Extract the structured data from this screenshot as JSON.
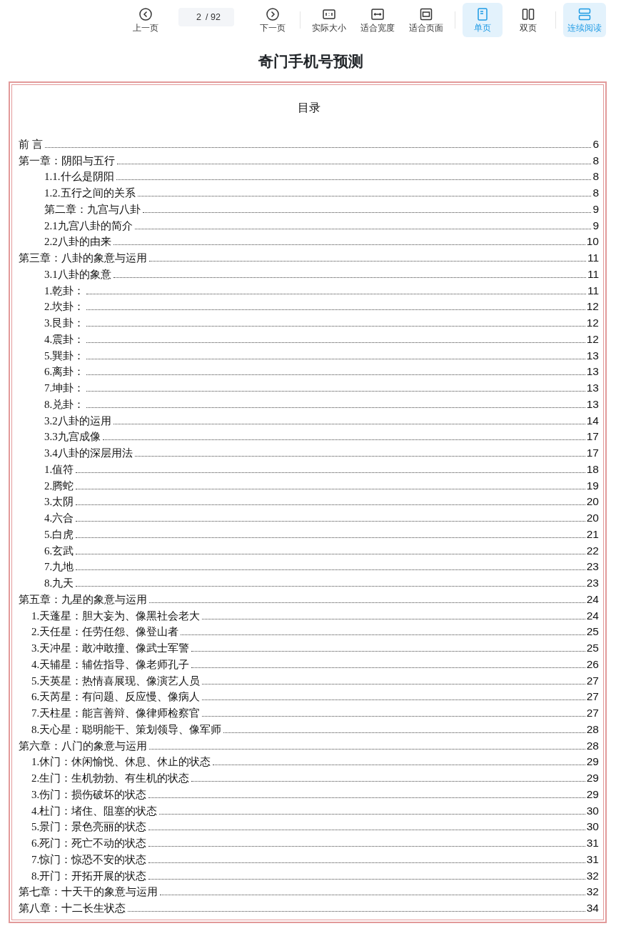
{
  "toolbar": {
    "items": [
      {
        "kind": "prev",
        "label": "上一页"
      },
      {
        "kind": "page",
        "value": "2",
        "total": "/ 92"
      },
      {
        "kind": "next",
        "label": "下一页"
      },
      {
        "kind": "sep"
      },
      {
        "kind": "actual",
        "label": "实际大小"
      },
      {
        "kind": "fitwidth",
        "label": "适合宽度"
      },
      {
        "kind": "fitpage",
        "label": "适合页面"
      },
      {
        "kind": "sep"
      },
      {
        "kind": "single",
        "label": "单页",
        "selected": true
      },
      {
        "kind": "double",
        "label": "双页",
        "selected": false
      },
      {
        "kind": "sep"
      },
      {
        "kind": "continuous",
        "label": "连续阅读",
        "selected": true
      }
    ]
  },
  "document": {
    "title": "奇门手机号预测",
    "toc_heading": "目录",
    "entries": [
      {
        "label": "前 言",
        "page": "6"
      },
      {
        "label": "第一章：阴阳与五行",
        "page": "8",
        "children": [
          {
            "label": "1.1.什么是阴阳",
            "page": "8",
            "kind": "section"
          },
          {
            "label": "1.2.五行之间的关系",
            "page": "8",
            "kind": "section"
          },
          {
            "label": "第二章：九宫与八卦",
            "page": "9",
            "kind": "section"
          },
          {
            "label": "2.1九宫八卦的简介",
            "page": "9",
            "kind": "section"
          },
          {
            "label": "2.2八卦的由来",
            "page": "10",
            "kind": "section"
          }
        ]
      },
      {
        "label": "第三章：八卦的象意与运用",
        "page": "11",
        "children": [
          {
            "label": "3.1八卦的象意",
            "page": "11",
            "kind": "section"
          },
          {
            "label": "1.乾卦：",
            "page": "11",
            "kind": "section"
          },
          {
            "label": "2.坎卦：",
            "page": "12",
            "kind": "section"
          },
          {
            "label": "3.艮卦：",
            "page": "12",
            "kind": "section"
          },
          {
            "label": "4.震卦：",
            "page": "12",
            "kind": "section"
          },
          {
            "label": "5.巽卦：",
            "page": "13",
            "kind": "section"
          },
          {
            "label": "6.离卦：",
            "page": "13",
            "kind": "section"
          },
          {
            "label": "7.坤卦：",
            "page": "13",
            "kind": "section"
          },
          {
            "label": "8.兑卦：",
            "page": "13",
            "kind": "section"
          },
          {
            "label": "3.2八卦的运用",
            "page": "14",
            "kind": "section"
          },
          {
            "label": "3.3九宫成像",
            "page": "17",
            "kind": "section"
          },
          {
            "label": "3.4八卦的深层用法",
            "page": "17",
            "kind": "section"
          },
          {
            "label": "1.值符",
            "page": "18",
            "kind": "section"
          },
          {
            "label": "2.腾蛇",
            "page": "19",
            "kind": "section"
          },
          {
            "label": "3.太阴",
            "page": "20",
            "kind": "section"
          },
          {
            "label": "4.六合",
            "page": "20",
            "kind": "section"
          },
          {
            "label": "5.白虎",
            "page": "21",
            "kind": "section"
          },
          {
            "label": "6.玄武",
            "page": "22",
            "kind": "section"
          },
          {
            "label": "7.九地",
            "page": "23",
            "kind": "section"
          },
          {
            "label": "8.九天",
            "page": "23",
            "kind": "section"
          }
        ]
      },
      {
        "label": "第五章：九星的象意与运用",
        "page": "24",
        "children": [
          {
            "label": "1.天蓬星：胆大妄为、像黑社会老大",
            "page": "24",
            "kind": "item"
          },
          {
            "label": "2.天任星：任劳任怨、像登山者",
            "page": "25",
            "kind": "item"
          },
          {
            "label": "3.天冲星：敢冲敢撞、像武士军警",
            "page": "25",
            "kind": "item"
          },
          {
            "label": "4.天辅星：辅佐指导、像老师孔子",
            "page": "26",
            "kind": "item"
          },
          {
            "label": "5.天英星：热情喜展现、像演艺人员",
            "page": "27",
            "kind": "item"
          },
          {
            "label": "6.天芮星：有问题、反应慢、像病人",
            "page": "27",
            "kind": "item"
          },
          {
            "label": "7.天柱星：能言善辩、像律师检察官",
            "page": "27",
            "kind": "item"
          },
          {
            "label": "8.天心星：聪明能干、策划领导、像军师",
            "page": "28",
            "kind": "item"
          }
        ]
      },
      {
        "label": "第六章：八门的象意与运用",
        "page": "28",
        "children": [
          {
            "label": "1.休门：休闲愉悦、休息、休止的状态",
            "page": "29",
            "kind": "item"
          },
          {
            "label": "2.生门：生机勃勃、有生机的状态",
            "page": "29",
            "kind": "item"
          },
          {
            "label": "3.伤门：损伤破坏的状态",
            "page": "29",
            "kind": "item"
          },
          {
            "label": "4.杜门：堵住、阻塞的状态",
            "page": "30",
            "kind": "item"
          },
          {
            "label": "5.景门：景色亮丽的状态",
            "page": "30",
            "kind": "item"
          },
          {
            "label": "6.死门：死亡不动的状态",
            "page": "31",
            "kind": "item"
          },
          {
            "label": "7.惊门：惊恐不安的状态",
            "page": "31",
            "kind": "item"
          },
          {
            "label": "8.开门：开拓开展的状态",
            "page": "32",
            "kind": "item"
          }
        ]
      },
      {
        "label": "第七章：十天干的象意与运用",
        "page": "32"
      },
      {
        "label": "第八章：十二长生状态",
        "page": "34"
      }
    ]
  }
}
